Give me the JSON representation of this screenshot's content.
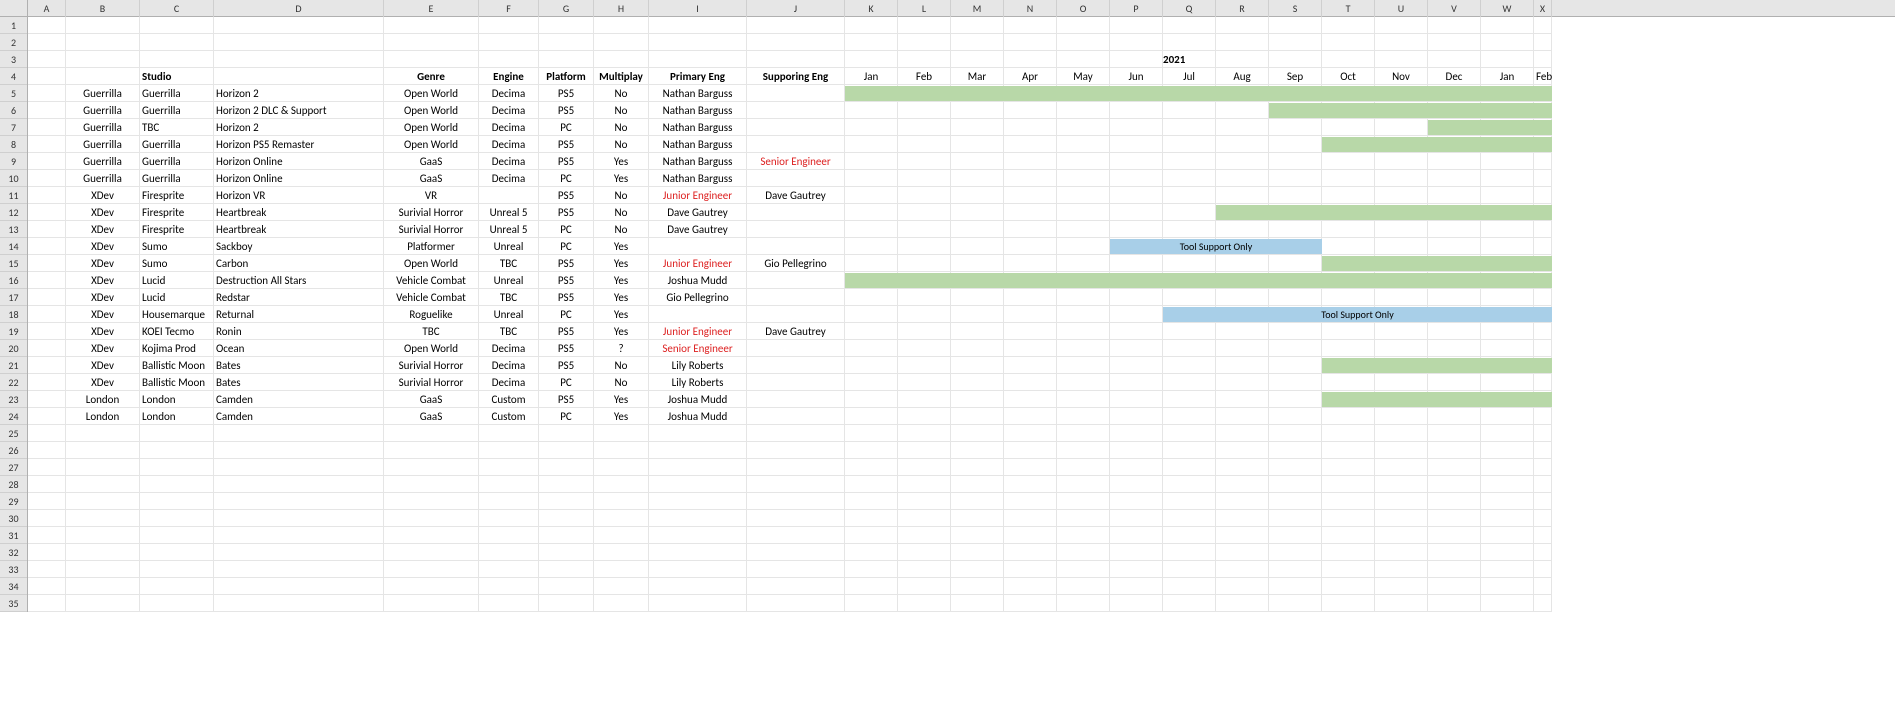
{
  "timeline_year_label": "2021",
  "columns": {
    "letters": [
      "A",
      "B",
      "C",
      "D",
      "E",
      "F",
      "G",
      "H",
      "I",
      "J",
      "K",
      "L",
      "M",
      "N",
      "O",
      "P",
      "Q",
      "R",
      "S",
      "T",
      "U",
      "V",
      "W",
      "X"
    ],
    "widths": [
      38,
      74,
      74,
      170,
      95,
      60,
      55,
      55,
      98,
      98,
      53,
      53,
      53,
      53,
      53,
      53,
      53,
      53,
      53,
      53,
      53,
      53,
      53,
      18
    ]
  },
  "row_count": 35,
  "headers": {
    "studio": "Studio",
    "genre": "Genre",
    "engine": "Engine",
    "platform": "Platform",
    "multiplay": "Multiplay",
    "primary_eng": "Primary Eng",
    "supporting_eng": "Supporing Eng"
  },
  "months": [
    "Jan",
    "Feb",
    "Mar",
    "Apr",
    "May",
    "Jun",
    "Jul",
    "Aug",
    "Sep",
    "Oct",
    "Nov",
    "Dec",
    "Jan",
    "Feb"
  ],
  "rows": [
    {
      "b": "Guerrilla",
      "c": "Guerrilla",
      "d": "Horizon 2",
      "e": "Open World",
      "f": "Decima",
      "g": "PS5",
      "h": "No",
      "i": "Nathan Barguss",
      "j": "",
      "bar": {
        "type": "green",
        "start": 0,
        "end": 14
      }
    },
    {
      "b": "Guerrilla",
      "c": "Guerrilla",
      "d": "Horizon 2 DLC & Support",
      "e": "Open World",
      "f": "Decima",
      "g": "PS5",
      "h": "No",
      "i": "Nathan Barguss",
      "j": "",
      "bar": {
        "type": "green",
        "start": 8,
        "end": 14
      }
    },
    {
      "b": "Guerrilla",
      "c": "TBC",
      "d": "Horizon 2",
      "e": "Open World",
      "f": "Decima",
      "g": "PC",
      "h": "No",
      "i": "Nathan Barguss",
      "j": "",
      "bar": {
        "type": "green",
        "start": 11,
        "end": 14
      }
    },
    {
      "b": "Guerrilla",
      "c": "Guerrilla",
      "d": "Horizon PS5 Remaster",
      "e": "Open World",
      "f": "Decima",
      "g": "PS5",
      "h": "No",
      "i": "Nathan Barguss",
      "j": "",
      "bar": {
        "type": "green",
        "start": 9,
        "end": 14
      }
    },
    {
      "b": "Guerrilla",
      "c": "Guerrilla",
      "d": "Horizon Online",
      "e": "GaaS",
      "f": "Decima",
      "g": "PS5",
      "h": "Yes",
      "i": "Nathan Barguss",
      "j": "Senior Engineer",
      "j_red": true,
      "bar": null
    },
    {
      "b": "Guerrilla",
      "c": "Guerrilla",
      "d": "Horizon Online",
      "e": "GaaS",
      "f": "Decima",
      "g": "PC",
      "h": "Yes",
      "i": "Nathan Barguss",
      "j": "",
      "bar": null
    },
    {
      "b": "XDev",
      "c": "Firesprite",
      "d": "Horizon VR",
      "e": "VR",
      "f": "",
      "g": "PS5",
      "h": "No",
      "i": "Junior Engineer",
      "i_red": true,
      "j": "Dave Gautrey",
      "bar": null
    },
    {
      "b": "XDev",
      "c": "Firesprite",
      "d": "Heartbreak",
      "e": "Surivial Horror",
      "f": "Unreal 5",
      "g": "PS5",
      "h": "No",
      "i": "Dave Gautrey",
      "j": "",
      "bar": {
        "type": "green",
        "start": 7,
        "end": 14
      }
    },
    {
      "b": "XDev",
      "c": "Firesprite",
      "d": "Heartbreak",
      "e": "Surivial Horror",
      "f": "Unreal 5",
      "g": "PC",
      "h": "No",
      "i": "Dave Gautrey",
      "j": "",
      "bar": null
    },
    {
      "b": "XDev",
      "c": "Sumo",
      "d": "Sackboy",
      "e": "Platformer",
      "f": "Unreal",
      "g": "PC",
      "h": "Yes",
      "i": "",
      "j": "",
      "bar": {
        "type": "blue",
        "start": 5,
        "end": 9,
        "label": "Tool Support Only"
      }
    },
    {
      "b": "XDev",
      "c": "Sumo",
      "d": "Carbon",
      "e": "Open World",
      "f": "TBC",
      "g": "PS5",
      "h": "Yes",
      "i": "Junior Engineer",
      "i_red": true,
      "j": "Gio Pellegrino",
      "bar": {
        "type": "green",
        "start": 9,
        "end": 14
      }
    },
    {
      "b": "XDev",
      "c": "Lucid",
      "d": "Destruction All Stars",
      "e": "Vehicle Combat",
      "f": "Unreal",
      "g": "PS5",
      "h": "Yes",
      "i": "Joshua Mudd",
      "j": "",
      "bar": {
        "type": "green",
        "start": 0,
        "end": 14
      }
    },
    {
      "b": "XDev",
      "c": "Lucid",
      "d": "Redstar",
      "e": "Vehicle Combat",
      "f": "TBC",
      "g": "PS5",
      "h": "Yes",
      "i": "Gio Pellegrino",
      "j": "",
      "bar": null
    },
    {
      "b": "XDev",
      "c": "Housemarque",
      "d": "Returnal",
      "e": "Roguelike",
      "f": "Unreal",
      "g": "PC",
      "h": "Yes",
      "i": "",
      "j": "",
      "bar": {
        "type": "blue",
        "start": 6,
        "end": 14,
        "label": "Tool Support Only"
      }
    },
    {
      "b": "XDev",
      "c": "KOEI Tecmo",
      "d": "Ronin",
      "e": "TBC",
      "f": "TBC",
      "g": "PS5",
      "h": "Yes",
      "i": "Junior Engineer",
      "i_red": true,
      "j": "Dave Gautrey",
      "bar": null
    },
    {
      "b": "XDev",
      "c": "Kojima Prod",
      "d": "Ocean",
      "e": "Open World",
      "f": "Decima",
      "g": "PS5",
      "h": "?",
      "i": "Senior Engineer",
      "i_red": true,
      "j": "",
      "bar": null
    },
    {
      "b": "XDev",
      "c": "Ballistic Moon",
      "d": "Bates",
      "e": "Surivial Horror",
      "f": "Decima",
      "g": "PS5",
      "h": "No",
      "i": "Lily Roberts",
      "j": "",
      "bar": {
        "type": "green",
        "start": 9,
        "end": 14
      }
    },
    {
      "b": "XDev",
      "c": "Ballistic Moon",
      "d": "Bates",
      "e": "Surivial Horror",
      "f": "Decima",
      "g": "PC",
      "h": "No",
      "i": "Lily Roberts",
      "j": "",
      "bar": null
    },
    {
      "b": "London",
      "c": "London",
      "d": "Camden",
      "e": "GaaS",
      "f": "Custom",
      "g": "PS5",
      "h": "Yes",
      "i": "Joshua Mudd",
      "j": "",
      "bar": {
        "type": "green",
        "start": 9,
        "end": 14
      }
    },
    {
      "b": "London",
      "c": "London",
      "d": "Camden",
      "e": "GaaS",
      "f": "Custom",
      "g": "PC",
      "h": "Yes",
      "i": "Joshua Mudd",
      "j": "",
      "bar": null
    }
  ]
}
